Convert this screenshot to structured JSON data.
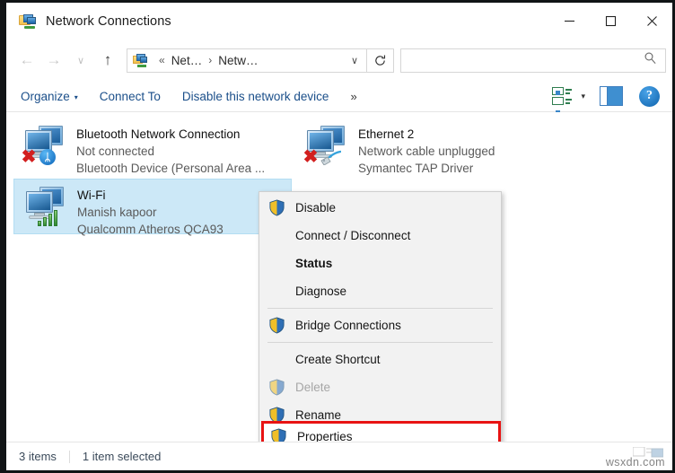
{
  "window": {
    "title": "Network Connections",
    "icon": "network-folder-icon",
    "minimize_label": "─",
    "maximize_label": "□",
    "close_label": "✕"
  },
  "nav": {
    "back_label": "←",
    "forward_label": "→",
    "recent_label": "∨",
    "up_label": "↑",
    "refresh_label": "↻",
    "breadcrumb": {
      "overflow": "«",
      "crumb1": "Net…",
      "separator": "›",
      "crumb2": "Netw…",
      "dropdown": "∨"
    }
  },
  "search": {
    "value": "",
    "placeholder": "",
    "icon": "search-icon"
  },
  "commandbar": {
    "organize": "Organize",
    "organize_caret": "▾",
    "connect_to": "Connect To",
    "disable_device": "Disable this network device",
    "overflow": "»",
    "view_caret": "▾",
    "help_label": "?"
  },
  "connections": [
    {
      "name": "Bluetooth Network Connection",
      "status": "Not connected",
      "driver": "Bluetooth Device (Personal Area ...",
      "badge": "bluetooth-icon",
      "badge_glyph": "ᛦ",
      "disconnected": true,
      "selected": false
    },
    {
      "name": "Ethernet 2",
      "status": "Network cable unplugged",
      "driver": "Symantec TAP Driver",
      "badge": "rj45-cable-icon",
      "badge_glyph": "",
      "disconnected": true,
      "selected": false
    },
    {
      "name": "Wi-Fi",
      "status": "Manish kapoor",
      "driver": "Qualcomm Atheros QCA93",
      "badge": "signal-bars-icon",
      "badge_glyph": "",
      "disconnected": false,
      "selected": true
    }
  ],
  "context_menu": {
    "items": [
      {
        "label": "Disable",
        "shield": true,
        "bold": false,
        "disabled": false,
        "separator_after": false
      },
      {
        "label": "Connect / Disconnect",
        "shield": false,
        "bold": false,
        "disabled": false,
        "separator_after": false
      },
      {
        "label": "Status",
        "shield": false,
        "bold": true,
        "disabled": false,
        "separator_after": false
      },
      {
        "label": "Diagnose",
        "shield": false,
        "bold": false,
        "disabled": false,
        "separator_after": true
      },
      {
        "label": "Bridge Connections",
        "shield": true,
        "bold": false,
        "disabled": false,
        "separator_after": true
      },
      {
        "label": "Create Shortcut",
        "shield": false,
        "bold": false,
        "disabled": false,
        "separator_after": false
      },
      {
        "label": "Delete",
        "shield": true,
        "bold": false,
        "disabled": true,
        "separator_after": false
      },
      {
        "label": "Rename",
        "shield": true,
        "bold": false,
        "disabled": false,
        "separator_after": true
      },
      {
        "label": "Properties",
        "shield": true,
        "bold": false,
        "disabled": false,
        "separator_after": false
      }
    ],
    "highlighted_item": "Properties",
    "highlight_color": "#e81313"
  },
  "statusbar": {
    "item_count": "3 items",
    "selection": "1 item selected"
  },
  "watermark": "wsxdn.com"
}
